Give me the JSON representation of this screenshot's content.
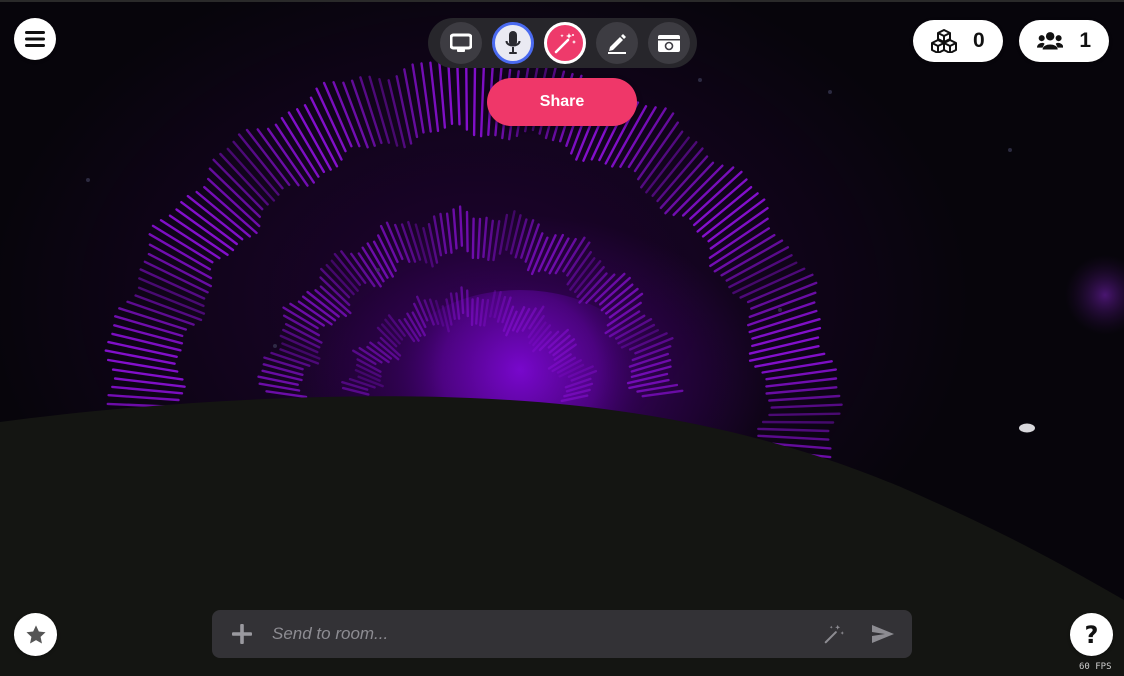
{
  "app": {
    "accent_color": "#ef3769",
    "active_tool_color": "#4a6af0"
  },
  "scene": {
    "background_color": "#07050b",
    "ground_color": "#141512",
    "visualizer_color": "#8a10d6"
  },
  "top_left": {
    "menu_icon": "hamburger-icon"
  },
  "toolbar": {
    "tools": [
      {
        "id": "screen",
        "icon": "screen-share-icon"
      },
      {
        "id": "mic",
        "icon": "microphone-icon",
        "active": true
      },
      {
        "id": "effects",
        "icon": "magic-wand-icon",
        "active": true
      },
      {
        "id": "draw",
        "icon": "pen-icon"
      },
      {
        "id": "camera",
        "icon": "camera-icon"
      }
    ]
  },
  "share": {
    "label": "Share"
  },
  "counters": {
    "objects": {
      "icon": "cubes-icon",
      "count": "0"
    },
    "members": {
      "icon": "users-icon",
      "count": "1"
    }
  },
  "chat": {
    "placeholder": "Send to room...",
    "add_icon": "plus-icon",
    "wand_icon": "magic-wand-icon",
    "send_icon": "send-icon"
  },
  "bottom": {
    "favorite_icon": "star-icon",
    "help_label": "?"
  },
  "status": {
    "fps": "60 FPS"
  }
}
